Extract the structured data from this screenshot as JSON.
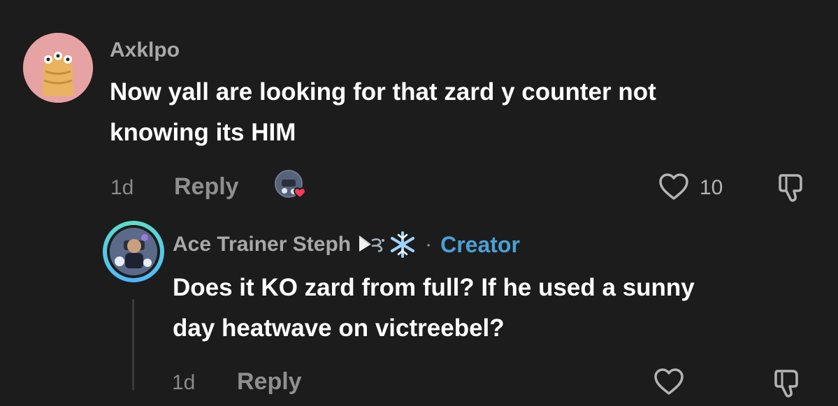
{
  "comments": [
    {
      "username": "Axklpo",
      "text_line1": "Now yall are looking for that zard y counter not",
      "text_line2": "knowing its HIM",
      "time": "1d",
      "reply_label": "Reply",
      "like_count": "10"
    }
  ],
  "reply": {
    "username": "Ace Trainer Steph",
    "separator": "·",
    "badge": "Creator",
    "text_line1": "Does it KO zard from full? If he used a sunny",
    "text_line2": "day heatwave on victreebel?",
    "time": "1d",
    "reply_label": "Reply"
  },
  "colors": {
    "background": "#1c1c1c",
    "creator": "#4aa0d4",
    "heart_badge": "#ff3b5c"
  },
  "icons": [
    "heart-icon",
    "dislike-icon",
    "liked-by-creator-icon"
  ]
}
